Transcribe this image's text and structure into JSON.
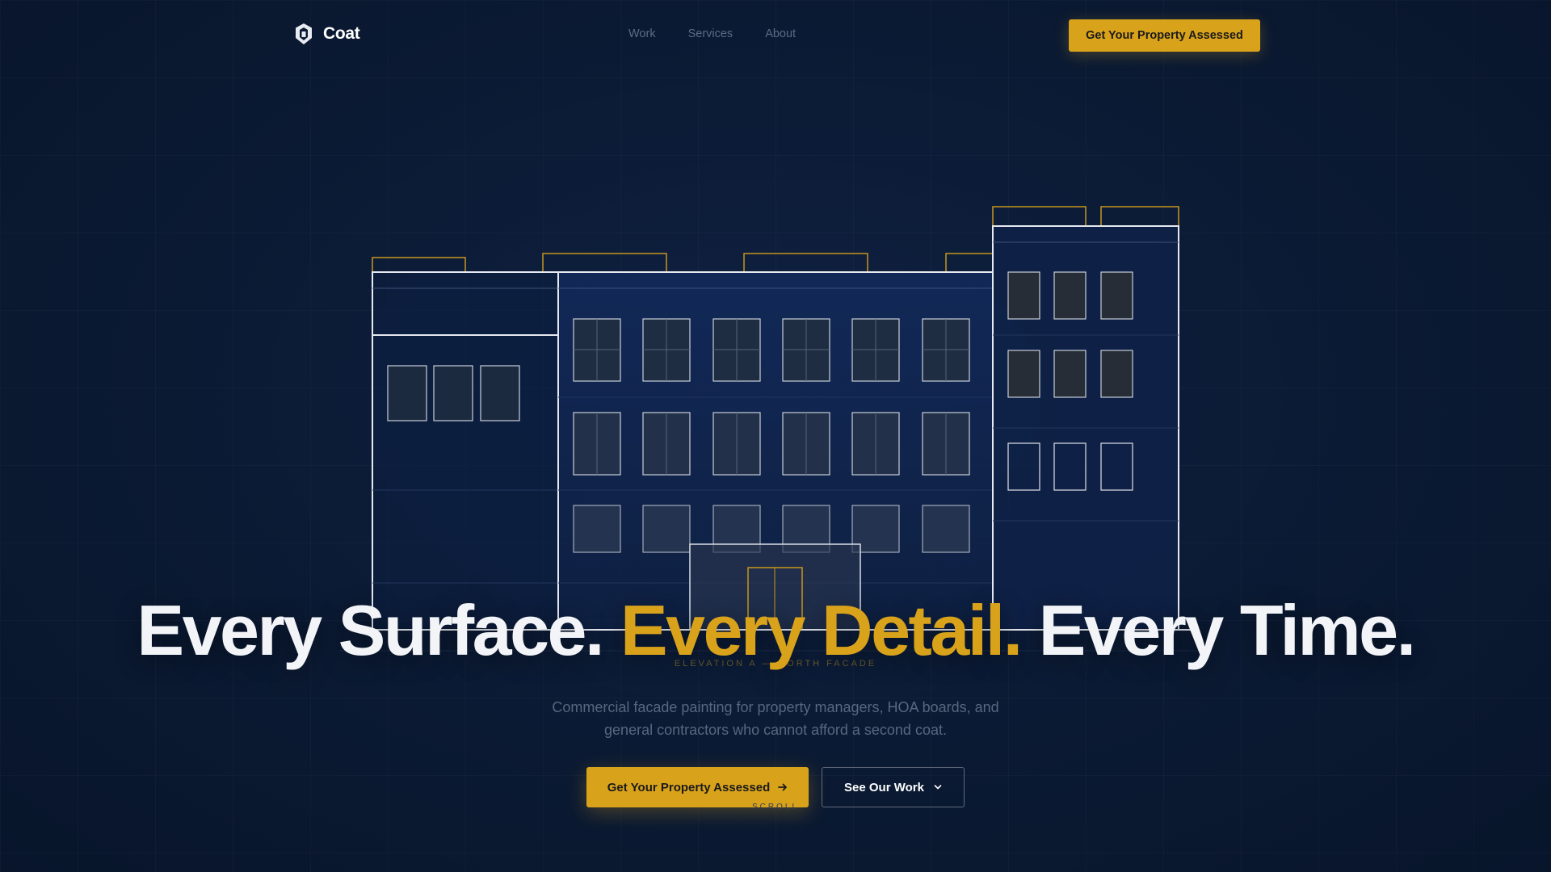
{
  "brand": {
    "name": "Coat",
    "icon": "coat-logo-icon"
  },
  "nav": {
    "links": [
      "Work",
      "Services",
      "About"
    ],
    "cta_label": "Get Your Property Assessed"
  },
  "hero": {
    "headline_part1": "Every Surface. ",
    "headline_accent": "Every Detail.",
    "headline_part3": " Every Time.",
    "subtitle": "Commercial facade painting for property managers, HOA boards, and general contractors who cannot afford a second coat.",
    "primary_cta_label": "Get Your Property Assessed",
    "primary_cta_icon": "arrow-right-icon",
    "secondary_cta_label": "See Our Work",
    "secondary_cta_icon": "chevron-down-icon",
    "scroll_label": "SCROLL"
  },
  "illustration": {
    "label": "ELEVATION A — NORTH FACADE"
  },
  "colors": {
    "background": "#0b1a33",
    "accent": "#d9a21b",
    "text": "#f2f4f8",
    "muted": "#58677f"
  }
}
